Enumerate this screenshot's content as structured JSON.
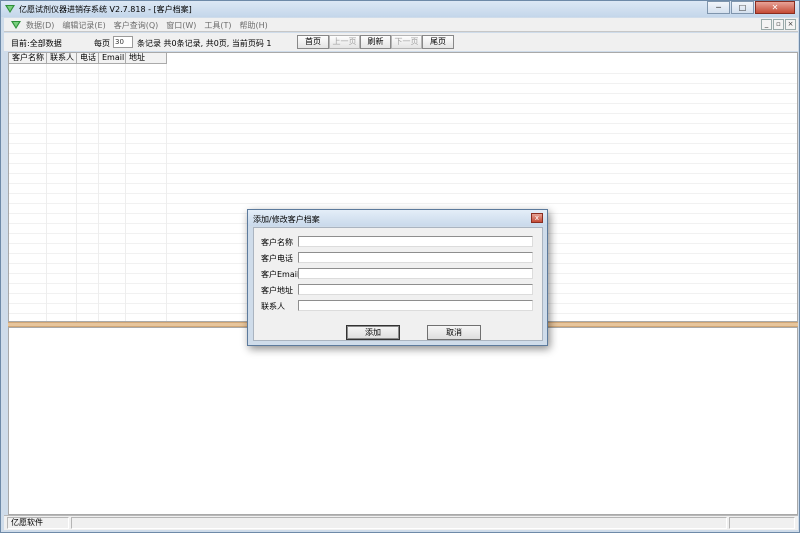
{
  "window": {
    "title": "亿愿试剂仪器进销存系统 V2.7.818 - [客户档案]",
    "controls": [
      "─",
      "□",
      "✕"
    ]
  },
  "menubar": {
    "items": [
      "数据(D)",
      "编辑记录(E)",
      "客户查询(Q)",
      "窗口(W)",
      "工具(T)",
      "帮助(H)"
    ],
    "mdi_controls": [
      "_",
      "▫",
      "×"
    ]
  },
  "toolbar": {
    "directory": "目前:全部数据",
    "per_page_label": "每页",
    "per_page_value": "30",
    "records_text": "条记录  共0条记录, 共0页, 当前页码  1",
    "first_page": "首页",
    "prev_page": "上一页",
    "refresh": "刷新",
    "next_page": "下一页",
    "last_page": "尾页"
  },
  "grid": {
    "columns": [
      "客户名称",
      "联系人",
      "电话",
      "Email",
      "地址"
    ]
  },
  "statusbar": {
    "company": "亿愿软件"
  },
  "dialog": {
    "title": "添加/修改客户档案",
    "close": "x",
    "fields": [
      {
        "label": "客户名称",
        "value": ""
      },
      {
        "label": "客户电话",
        "value": ""
      },
      {
        "label": "客户Email",
        "value": ""
      },
      {
        "label": "客户地址",
        "value": ""
      },
      {
        "label": "联系人",
        "value": ""
      }
    ],
    "add_button": "添加",
    "cancel_button": "取消"
  },
  "colors": {
    "window_frame": "#cfdcea",
    "splitter": "#e7c59c",
    "close_red": "#c44b36"
  }
}
